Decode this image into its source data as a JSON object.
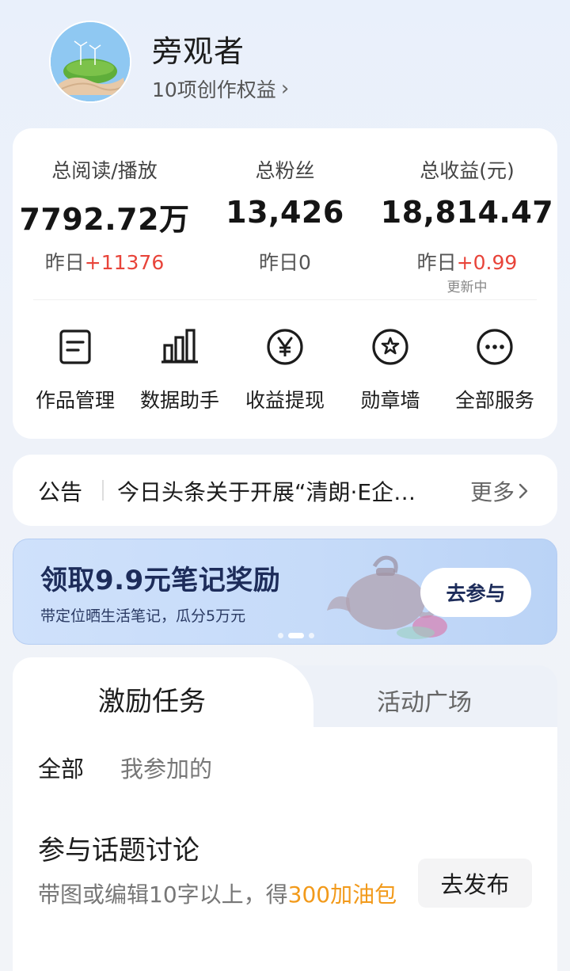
{
  "profile": {
    "username": "旁观者",
    "rights_label": "10项创作权益",
    "chevron": "›"
  },
  "stats": [
    {
      "label": "总阅读/播放",
      "value": "7792.72万",
      "delta_prefix": "昨日",
      "delta_value": "+11376",
      "update": ""
    },
    {
      "label": "总粉丝",
      "value": "13,426",
      "delta_prefix": "昨日",
      "delta_value": "0",
      "update": ""
    },
    {
      "label": "总收益(元)",
      "value": "18,814.47",
      "delta_prefix": "昨日",
      "delta_value": "+0.99",
      "update": "更新中"
    }
  ],
  "services": [
    {
      "label": "作品管理",
      "icon": "document-icon"
    },
    {
      "label": "数据助手",
      "icon": "bar-chart-icon"
    },
    {
      "label": "收益提现",
      "icon": "yen-circle-icon"
    },
    {
      "label": "勋章墙",
      "icon": "star-badge-icon"
    },
    {
      "label": "全部服务",
      "icon": "more-circle-icon"
    }
  ],
  "notice": {
    "tag": "公告",
    "text": "今日头条关于开展“清朗·E企…",
    "more": "更多"
  },
  "banner": {
    "title": "领取9.9元笔记奖励",
    "subtitle": "带定位晒生活笔记，瓜分5万元",
    "button": "去参与",
    "page_count": 3,
    "active_page": 2
  },
  "tasks": {
    "tabs": [
      {
        "label": "激励任务",
        "active": true
      },
      {
        "label": "活动广场",
        "active": false
      }
    ],
    "filters": [
      {
        "label": "全部",
        "active": true
      },
      {
        "label": "我参加的",
        "active": false
      }
    ],
    "item": {
      "title": "参与话题讨论",
      "desc_prefix": "带图或编辑10字以上，得",
      "desc_highlight": "300加油包",
      "button": "去发布"
    }
  },
  "colors": {
    "accent_red": "#e8443a",
    "highlight_orange": "#f29a1b",
    "banner_bg": "#c6dbf9",
    "banner_text": "#1d2c5a"
  }
}
